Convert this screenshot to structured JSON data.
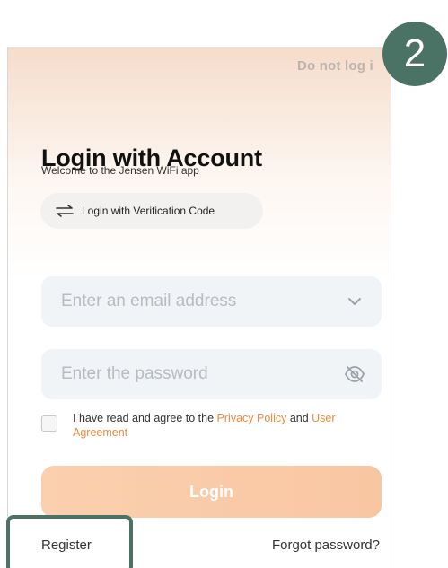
{
  "header": {
    "skip_label": "Do not log i"
  },
  "main": {
    "title": "Login with Account",
    "welcome": "Welcome to the Jensen WiFi app",
    "verify_button_label": "Login with Verification Code"
  },
  "form": {
    "email_placeholder": "Enter an email address",
    "email_value": "",
    "password_placeholder": "Enter the password",
    "password_value": ""
  },
  "agreement": {
    "checked": false,
    "prefix": "I have read and agree to the ",
    "privacy_link": "Privacy Policy",
    "middle": " and ",
    "agreement_link": "User Agreement"
  },
  "actions": {
    "login_label": "Login",
    "register_label": "Register",
    "forgot_label": "Forgot password?"
  },
  "annotation": {
    "step_number": "2",
    "color": "#4a7365"
  },
  "colors": {
    "accent_orange": "#f08a3c",
    "button_peach": "#fbd0ae",
    "field_bg": "#f1f4f7"
  },
  "icons": {
    "verify_switch": "swap-arrows-icon",
    "email_dropdown": "chevron-down-icon",
    "password_toggle": "eye-off-icon"
  }
}
